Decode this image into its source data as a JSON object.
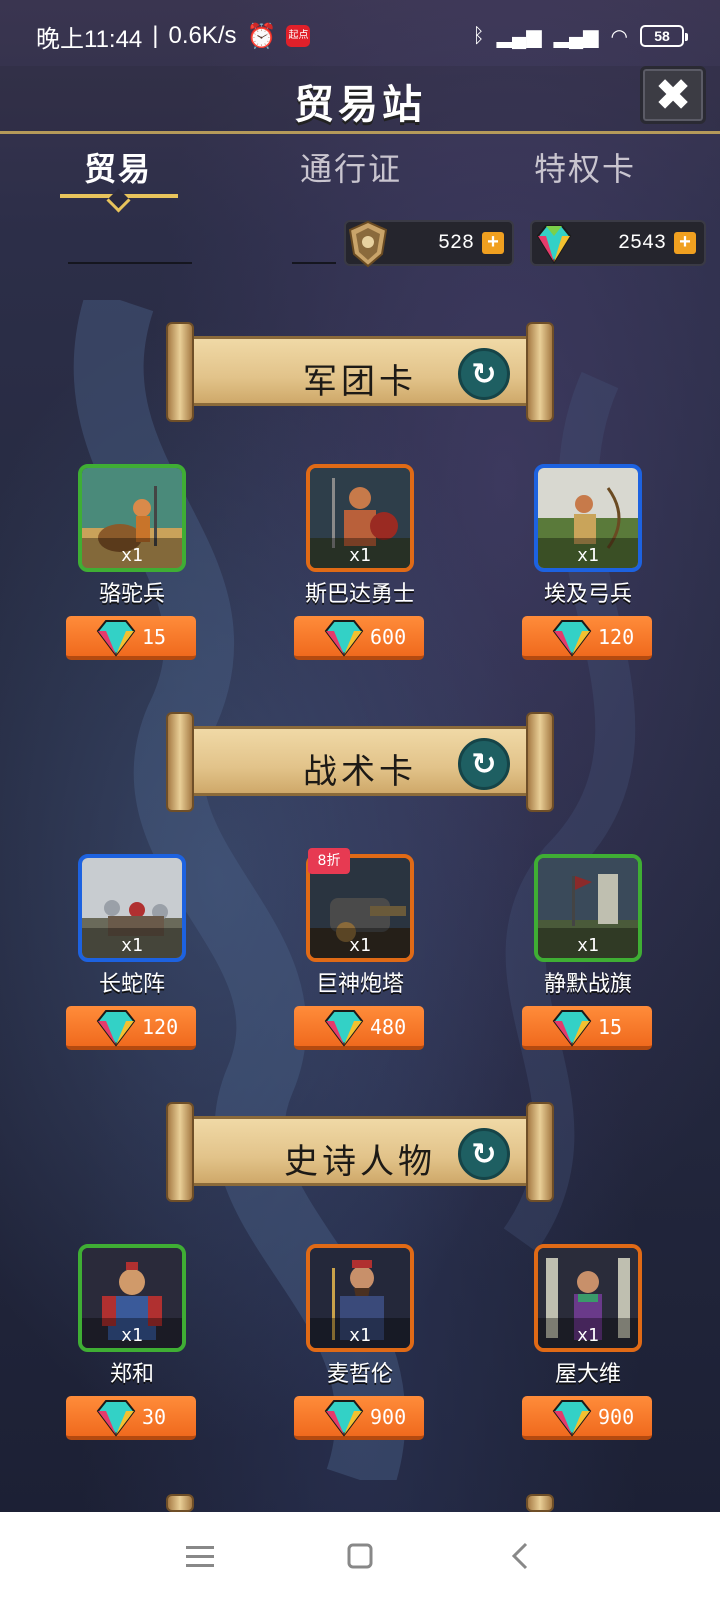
{
  "status_bar": {
    "time": "晚上11:44",
    "speed": "0.6K/s",
    "alarm_icon": "alarm-clock-icon",
    "app_badge": "起点",
    "battery": "58"
  },
  "header": {
    "title": "贸易站",
    "close_icon": "close-x-icon"
  },
  "tabs": [
    {
      "label": "贸易",
      "active": true
    },
    {
      "label": "通行证",
      "active": false
    },
    {
      "label": "特权卡",
      "active": false
    }
  ],
  "currencies": [
    {
      "icon": "shield-emblem-icon",
      "value": "528"
    },
    {
      "icon": "gem-icon",
      "value": "2543"
    }
  ],
  "sections": [
    {
      "title": "军团卡",
      "items": [
        {
          "name": "骆驼兵",
          "qty": "x1",
          "price": "15",
          "rarity": "green",
          "badge": ""
        },
        {
          "name": "斯巴达勇士",
          "qty": "x1",
          "price": "600",
          "rarity": "orange",
          "badge": ""
        },
        {
          "name": "埃及弓兵",
          "qty": "x1",
          "price": "120",
          "rarity": "blue",
          "badge": ""
        }
      ]
    },
    {
      "title": "战术卡",
      "items": [
        {
          "name": "长蛇阵",
          "qty": "x1",
          "price": "120",
          "rarity": "blue",
          "badge": ""
        },
        {
          "name": "巨神炮塔",
          "qty": "x1",
          "price": "480",
          "rarity": "orange",
          "badge": "8折"
        },
        {
          "name": "静默战旗",
          "qty": "x1",
          "price": "15",
          "rarity": "green",
          "badge": ""
        }
      ]
    },
    {
      "title": "史诗人物",
      "items": [
        {
          "name": "郑和",
          "qty": "x1",
          "price": "30",
          "rarity": "green",
          "badge": ""
        },
        {
          "name": "麦哲伦",
          "qty": "x1",
          "price": "900",
          "rarity": "orange",
          "badge": ""
        },
        {
          "name": "屋大维",
          "qty": "x1",
          "price": "900",
          "rarity": "orange",
          "badge": ""
        }
      ]
    }
  ],
  "nav": {
    "menu_icon": "menu-icon",
    "home_icon": "home-square-icon",
    "back_icon": "back-chevron-icon"
  },
  "colors": {
    "rarity_green": "#3fae34",
    "rarity_orange": "#e06a16",
    "rarity_blue": "#1d62e0",
    "price_button": "#f06a1e",
    "tab_accent": "#e8c45c"
  }
}
